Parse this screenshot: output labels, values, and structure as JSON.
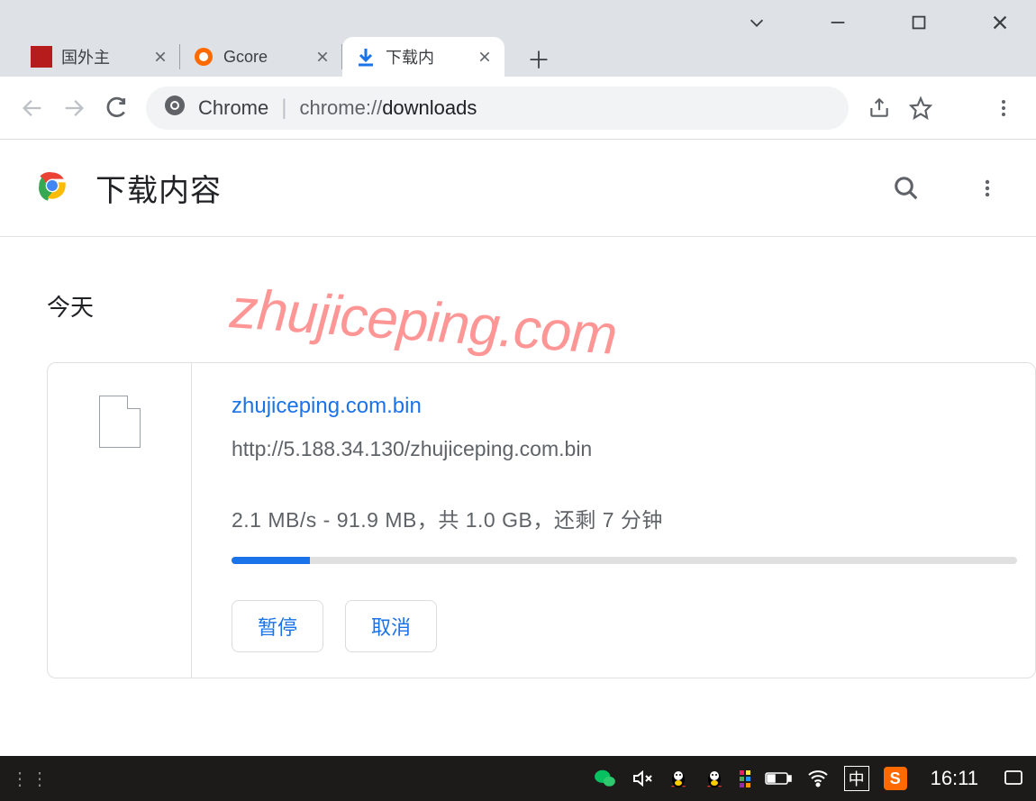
{
  "tabs": [
    {
      "title": "国外主",
      "icon": "site-a"
    },
    {
      "title": "Gcore",
      "icon": "site-gcore"
    },
    {
      "title": "下载内",
      "icon": "download",
      "active": true
    }
  ],
  "toolbar": {
    "site_label": "Chrome",
    "url_prefix": "chrome://",
    "url_main": "downloads"
  },
  "page": {
    "title": "下载内容",
    "date_label": "今天"
  },
  "download": {
    "filename": "zhujiceping.com.bin",
    "url": "http://5.188.34.130/zhujiceping.com.bin",
    "status": "2.1 MB/s - 91.9 MB，共 1.0 GB，还剩 7 分钟",
    "progress_percent": 10,
    "pause_label": "暂停",
    "cancel_label": "取消"
  },
  "watermark": "zhujiceping.com",
  "taskbar": {
    "clock": "16:11",
    "ime": "中"
  }
}
